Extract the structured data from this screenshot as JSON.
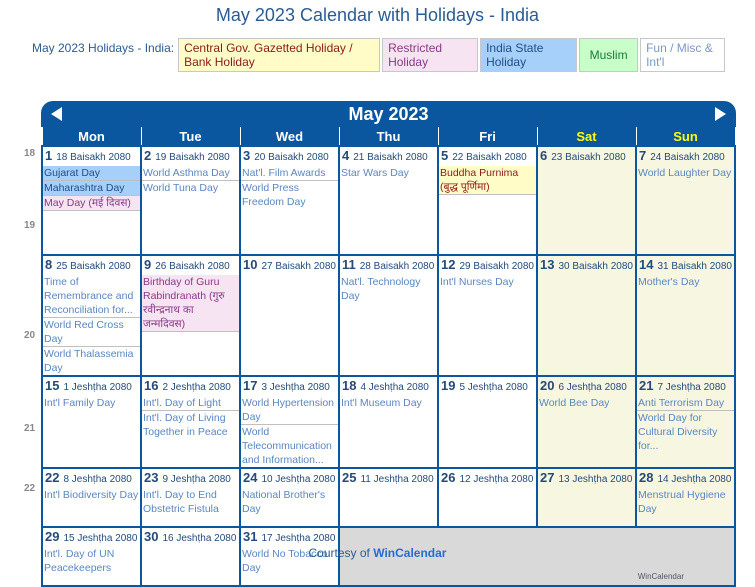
{
  "page": {
    "title": "May 2023 Calendar with Holidays - India",
    "courtesy_prefix": "Courtesy of",
    "courtesy_link": "WinCalendar",
    "watermark": "WinCalendar"
  },
  "legend": {
    "label": "May 2023 Holidays - India:",
    "items": [
      {
        "label": "Central Gov. Gazetted Holiday / Bank Holiday",
        "color": "#fffcc8"
      },
      {
        "label": "Restricted Holiday",
        "color": "#f6e4f2"
      },
      {
        "label": "India State Holiday",
        "color": "#a6cffa"
      },
      {
        "label": "Muslim",
        "color": "#c8ffc8"
      },
      {
        "label": "Fun / Misc & Int'l",
        "color": "#ffffff"
      }
    ]
  },
  "calendar": {
    "month_title": "May 2023",
    "prev_icon": "triangle-left-icon",
    "next_icon": "triangle-right-icon",
    "weekdays": [
      "Mon",
      "Tue",
      "Wed",
      "Thu",
      "Fri",
      "Sat",
      "Sun"
    ],
    "week_numbers": [
      "18",
      "19",
      "20",
      "21",
      "22"
    ],
    "weeks": [
      [
        {
          "day": "1",
          "info": "18 Baisakh 2080",
          "events": [
            {
              "t": "Gujarat Day",
              "k": "state"
            },
            {
              "t": "Maharashtra Day",
              "k": "state"
            },
            {
              "t": "May Day (मई दिवस)",
              "k": "restricted"
            }
          ]
        },
        {
          "day": "2",
          "info": "19 Baisakh 2080",
          "events": [
            {
              "t": "World Asthma Day",
              "k": "fun"
            },
            {
              "t": "World Tuna Day",
              "k": "fun"
            }
          ]
        },
        {
          "day": "3",
          "info": "20 Baisakh 2080",
          "events": [
            {
              "t": "Nat'l. Film Awards",
              "k": "fun"
            },
            {
              "t": "World Press Freedom Day",
              "k": "fun"
            }
          ]
        },
        {
          "day": "4",
          "info": "21 Baisakh 2080",
          "events": [
            {
              "t": "Star Wars Day",
              "k": "fun"
            }
          ]
        },
        {
          "day": "5",
          "info": "22 Baisakh 2080",
          "events": [
            {
              "t": "Buddha Purnima (बुद्ध पूर्णिमा)",
              "k": "central"
            }
          ]
        },
        {
          "day": "6",
          "info": "23 Baisakh 2080",
          "events": []
        },
        {
          "day": "7",
          "info": "24 Baisakh 2080",
          "events": [
            {
              "t": "World Laughter Day",
              "k": "fun"
            }
          ]
        }
      ],
      [
        {
          "day": "8",
          "info": "25 Baisakh 2080",
          "events": [
            {
              "t": "Time of Remembrance and Reconciliation for...",
              "k": "fun"
            },
            {
              "t": "World Red Cross Day",
              "k": "fun"
            },
            {
              "t": "World Thalassemia Day",
              "k": "fun"
            }
          ]
        },
        {
          "day": "9",
          "info": "26 Baisakh 2080",
          "events": [
            {
              "t": "Birthday of Guru Rabindranath (गुरु रवीन्द्रनाथ का जन्मदिवस)",
              "k": "restricted"
            }
          ]
        },
        {
          "day": "10",
          "info": "27 Baisakh 2080",
          "events": []
        },
        {
          "day": "11",
          "info": "28 Baisakh 2080",
          "events": [
            {
              "t": "Nat'l. Technology Day",
              "k": "fun"
            }
          ]
        },
        {
          "day": "12",
          "info": "29 Baisakh 2080",
          "events": [
            {
              "t": "Int'l Nurses Day",
              "k": "fun"
            }
          ]
        },
        {
          "day": "13",
          "info": "30 Baisakh 2080",
          "events": []
        },
        {
          "day": "14",
          "info": "31 Baisakh 2080",
          "events": [
            {
              "t": "Mother's Day",
              "k": "fun"
            }
          ]
        }
      ],
      [
        {
          "day": "15",
          "info": "1 Jeshṭha 2080",
          "events": [
            {
              "t": "Int'l Family Day",
              "k": "fun"
            }
          ]
        },
        {
          "day": "16",
          "info": "2 Jeshṭha 2080",
          "events": [
            {
              "t": "Int'l. Day of Light",
              "k": "fun"
            },
            {
              "t": "Int'l. Day of Living Together in Peace",
              "k": "fun"
            }
          ]
        },
        {
          "day": "17",
          "info": "3 Jeshṭha 2080",
          "events": [
            {
              "t": "World Hypertension Day",
              "k": "fun"
            },
            {
              "t": "World Telecommunication and Information...",
              "k": "fun"
            }
          ]
        },
        {
          "day": "18",
          "info": "4 Jeshṭha 2080",
          "events": [
            {
              "t": "Int'l Museum Day",
              "k": "fun"
            }
          ]
        },
        {
          "day": "19",
          "info": "5 Jeshṭha 2080",
          "events": []
        },
        {
          "day": "20",
          "info": "6 Jeshṭha 2080",
          "events": [
            {
              "t": "World Bee Day",
              "k": "fun"
            }
          ]
        },
        {
          "day": "21",
          "info": "7 Jeshṭha 2080",
          "events": [
            {
              "t": "Anti Terrorism Day",
              "k": "fun"
            },
            {
              "t": "World Day for Cultural Diversity for...",
              "k": "fun"
            }
          ]
        }
      ],
      [
        {
          "day": "22",
          "info": "8 Jeshṭha 2080",
          "events": [
            {
              "t": "Int'l Biodiversity Day",
              "k": "fun"
            }
          ]
        },
        {
          "day": "23",
          "info": "9 Jeshṭha 2080",
          "events": [
            {
              "t": "Int'l. Day to End Obstetric Fistula",
              "k": "fun"
            }
          ]
        },
        {
          "day": "24",
          "info": "10 Jeshṭha 2080",
          "events": [
            {
              "t": "National Brother's Day",
              "k": "fun"
            }
          ]
        },
        {
          "day": "25",
          "info": "11 Jeshṭha 2080",
          "events": []
        },
        {
          "day": "26",
          "info": "12 Jeshṭha 2080",
          "events": []
        },
        {
          "day": "27",
          "info": "13 Jeshṭha 2080",
          "events": []
        },
        {
          "day": "28",
          "info": "14 Jeshṭha 2080",
          "events": [
            {
              "t": "Menstrual Hygiene Day",
              "k": "fun"
            }
          ]
        }
      ],
      [
        {
          "day": "29",
          "info": "15 Jeshṭha 2080",
          "events": [
            {
              "t": "Int'l. Day of UN Peacekeepers",
              "k": "fun"
            }
          ]
        },
        {
          "day": "30",
          "info": "16 Jeshṭha 2080",
          "events": []
        },
        {
          "day": "31",
          "info": "17 Jeshṭha 2080",
          "events": [
            {
              "t": "World No Tobacco Day",
              "k": "fun"
            }
          ]
        }
      ]
    ]
  }
}
